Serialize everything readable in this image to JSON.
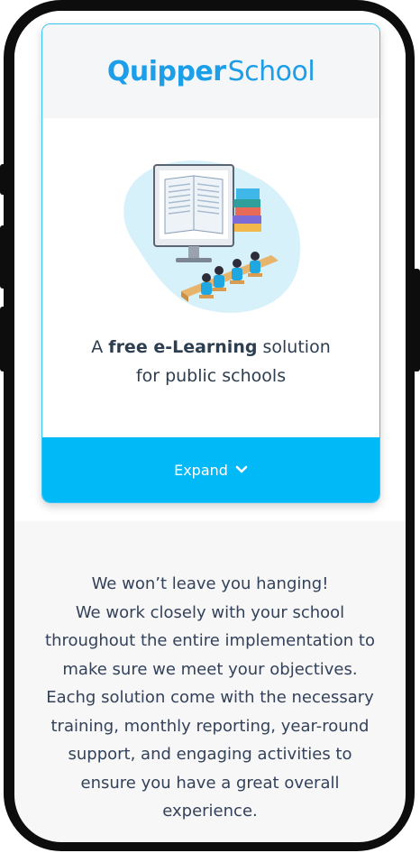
{
  "brand": {
    "logo_bold": "Quipper",
    "logo_light": "School"
  },
  "card": {
    "tagline_prefix": "A ",
    "tagline_bold": "free e-Learning",
    "tagline_suffix": " solution",
    "tagline_line2": "for public schools",
    "expand_label": "Expand"
  },
  "info": {
    "lines": [
      "We won’t leave you hanging!",
      "We work closely with your school",
      "throughout the entire implementation to",
      "make sure we meet your objectives.",
      "Eachg solution come with the necessary",
      "training, monthly reporting, year-round",
      "support, and engaging activities to",
      "ensure you have a great overall",
      "experience."
    ]
  },
  "colors": {
    "accent": "#01b9f7",
    "logo": "#1c9ee8",
    "text": "#33425a"
  },
  "icons": {
    "expand": "chevron-down-icon",
    "illustration": "classroom-elearning-illustration"
  }
}
